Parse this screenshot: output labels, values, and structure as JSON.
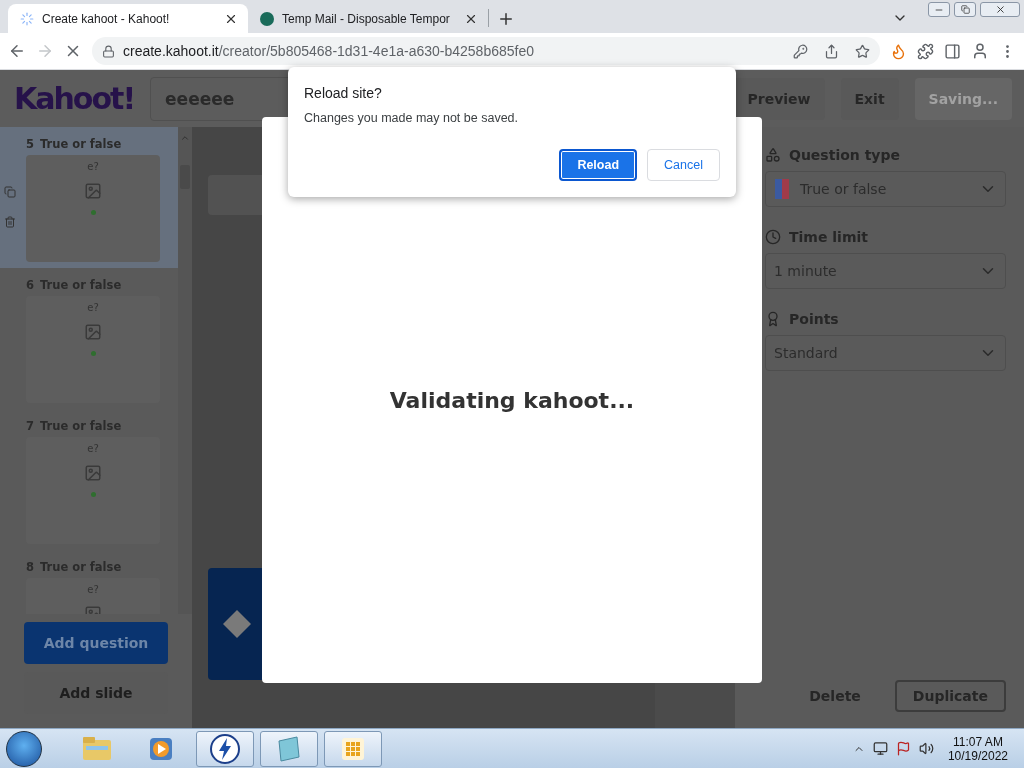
{
  "browser": {
    "tabs": [
      {
        "title": "Create kahoot - Kahoot!",
        "selected": true,
        "loading": true
      },
      {
        "title": "Temp Mail - Disposable Tempor",
        "selected": false,
        "loading": false
      }
    ],
    "forward_disabled": true,
    "address": {
      "host": "create.kahoot.it",
      "path": "/creator/5b805468-1d31-4e1a-a630-b4258b685fe0"
    }
  },
  "editor": {
    "logo": "Kahoot!",
    "title_field": "eeeeee",
    "header_buttons": [
      {
        "label": "Preview",
        "disabled": false
      },
      {
        "label": "Exit",
        "disabled": false
      },
      {
        "label": "Saving...",
        "disabled": true
      }
    ],
    "slides": [
      {
        "number": "5",
        "type": "True or false",
        "question": "e?",
        "selected": true
      },
      {
        "number": "6",
        "type": "True or false",
        "question": "e?",
        "selected": false
      },
      {
        "number": "7",
        "type": "True or false",
        "question": "e?",
        "selected": false
      },
      {
        "number": "8",
        "type": "True or false",
        "question": "e?",
        "selected": false
      }
    ],
    "add_question": "Add question",
    "add_slide": "Add slide",
    "settings": [
      {
        "kind": "question-type",
        "label": "Question type",
        "value": "True or false"
      },
      {
        "kind": "time",
        "label": "Time limit",
        "value": "1 minute"
      },
      {
        "kind": "points",
        "label": "Points",
        "value": "Standard"
      }
    ],
    "footer_buttons": [
      "Delete",
      "Duplicate"
    ]
  },
  "modal": {
    "message": "Validating kahoot..."
  },
  "dialog": {
    "title": "Reload site?",
    "message": "Changes you made may not be saved.",
    "buttons": [
      {
        "label": "Reload",
        "primary": true
      },
      {
        "label": "Cancel",
        "primary": false
      }
    ]
  },
  "taskbar": {
    "apps": [
      {
        "kind": "folder",
        "running": false
      },
      {
        "kind": "media",
        "running": false
      },
      {
        "kind": "bolt",
        "running": true
      },
      {
        "kind": "note",
        "running": true
      },
      {
        "kind": "grid",
        "running": true
      }
    ],
    "time": "11:07 AM",
    "date": "10/19/2022"
  }
}
